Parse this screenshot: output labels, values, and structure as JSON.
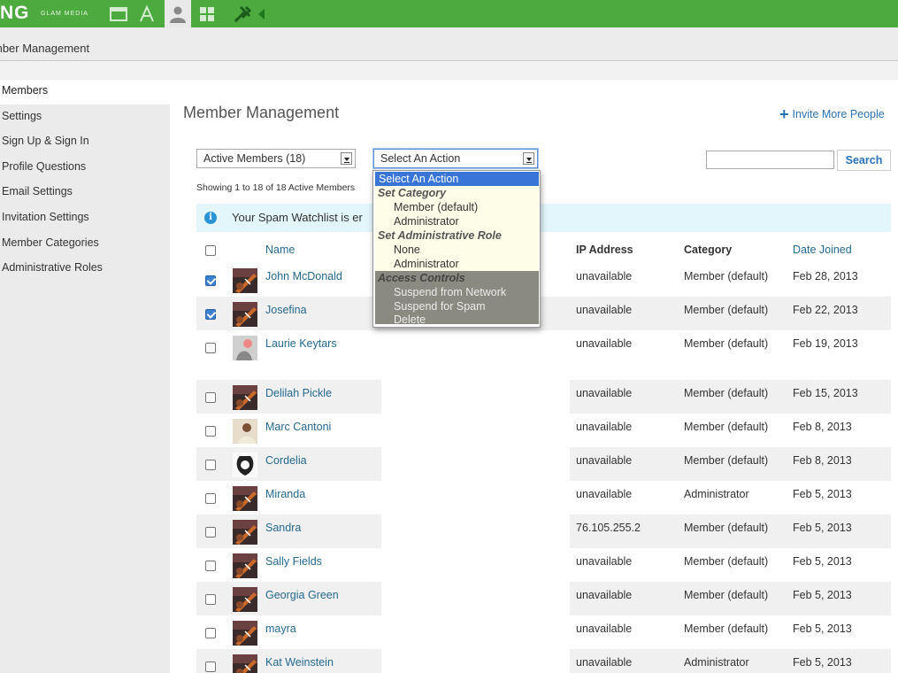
{
  "topbar": {
    "logo": "NG",
    "logo_sub": "GLAM MEDIA"
  },
  "titlebar": {
    "title": "mber Management"
  },
  "sidebar": {
    "items": [
      {
        "label": "Members",
        "active": true
      },
      {
        "label": "Settings"
      },
      {
        "label": "Sign Up & Sign In"
      },
      {
        "label": "Profile Questions"
      },
      {
        "label": "Email Settings"
      },
      {
        "label": "Invitation Settings"
      },
      {
        "label": "Member Categories"
      },
      {
        "label": "Administrative Roles"
      }
    ]
  },
  "main": {
    "title": "Member Management",
    "invite_label": "Invite More People",
    "filter_select": "Active Members (18)",
    "action_select": "Select An Action",
    "search_label": "Search",
    "showing": "Showing 1 to 18 of 18 Active Members",
    "notice": "Your Spam Watchlist is er",
    "columns": {
      "name": "Name",
      "ip": "IP Address",
      "category": "Category",
      "date": "Date Joined"
    }
  },
  "dropdown": {
    "selected": "Select An Action",
    "group1": "Set Category",
    "g1_opt1": "Member (default)",
    "g1_opt2": "Administrator",
    "group2": "Set Administrative Role",
    "g2_opt1": "None",
    "g2_opt2": "Administrator",
    "group3": "Access Controls",
    "g3_opt1": "Suspend from Network",
    "g3_opt2": "Suspend for Spam",
    "g3_opt3": "Delete"
  },
  "members": [
    {
      "name": "John McDonald",
      "ip": "unavailable",
      "category": "Member (default)",
      "date": "Feb 28, 2013",
      "checked": true,
      "avatar": "guitar"
    },
    {
      "name": "Josefina",
      "ip": "unavailable",
      "category": "Member (default)",
      "date": "Feb 22, 2013",
      "checked": true,
      "avatar": "guitar"
    },
    {
      "name": "Laurie Keytars",
      "ip": "unavailable",
      "category": "Member (default)",
      "date": "Feb 19, 2013",
      "checked": false,
      "avatar": "person-grey"
    },
    {
      "name": "Delilah Pickle",
      "ip": "unavailable",
      "category": "Member (default)",
      "date": "Feb 15, 2013",
      "checked": false,
      "avatar": "guitar"
    },
    {
      "name": "Marc Cantoni",
      "ip": "unavailable",
      "category": "Member (default)",
      "date": "Feb 8, 2013",
      "checked": false,
      "avatar": "person-photo"
    },
    {
      "name": "Cordelia",
      "ip": "unavailable",
      "category": "Member (default)",
      "date": "Feb 8, 2013",
      "checked": false,
      "avatar": "sketch"
    },
    {
      "name": "Miranda",
      "ip": "unavailable",
      "category": "Administrator",
      "date": "Feb 5, 2013",
      "checked": false,
      "avatar": "guitar"
    },
    {
      "name": "Sandra",
      "ip": "76.105.255.2",
      "category": "Member (default)",
      "date": "Feb 5, 2013",
      "checked": false,
      "avatar": "guitar"
    },
    {
      "name": "Sally Fields",
      "ip": "unavailable",
      "category": "Member (default)",
      "date": "Feb 5, 2013",
      "checked": false,
      "avatar": "guitar"
    },
    {
      "name": "Georgia Green",
      "ip": "unavailable",
      "category": "Member (default)",
      "date": "Feb 5, 2013",
      "checked": false,
      "avatar": "guitar"
    },
    {
      "name": "mayra",
      "ip": "unavailable",
      "category": "Member (default)",
      "date": "Feb 5, 2013",
      "checked": false,
      "avatar": "guitar"
    },
    {
      "name": "Kat Weinstein",
      "ip": "unavailable",
      "category": "Administrator",
      "date": "Feb 5, 2013",
      "checked": false,
      "avatar": "guitar"
    }
  ]
}
